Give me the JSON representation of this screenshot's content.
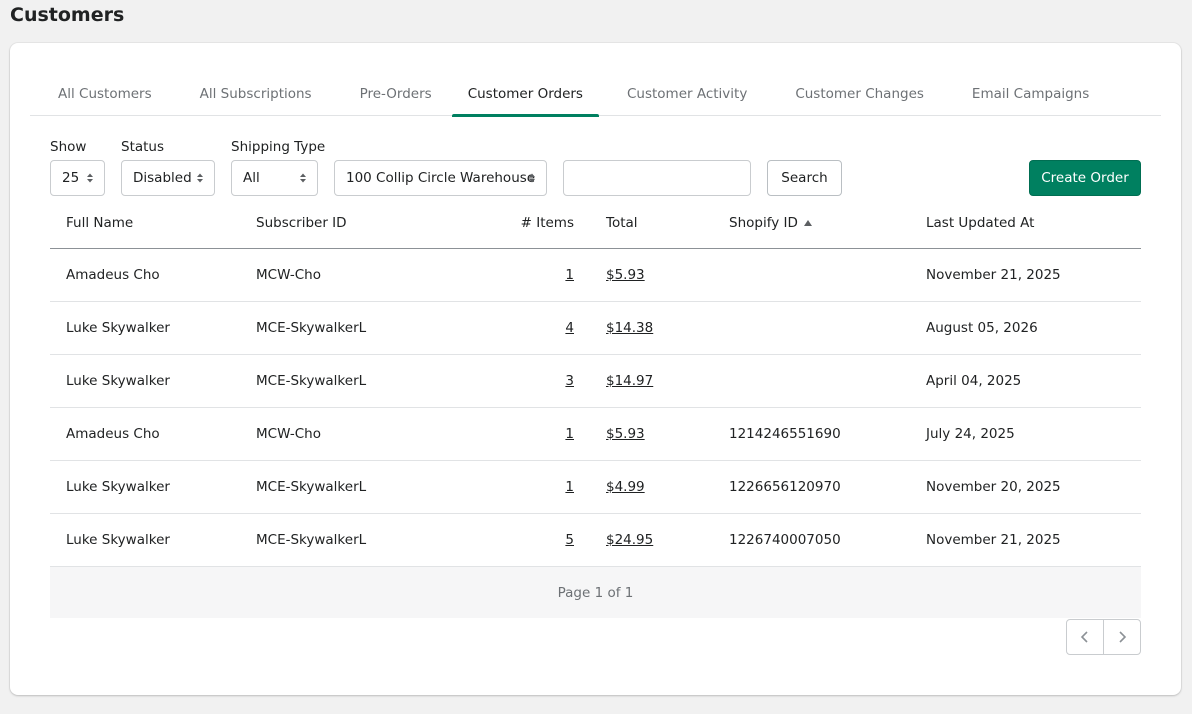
{
  "page": {
    "title": "Customers"
  },
  "tabs": [
    {
      "label": "All Customers",
      "active": false
    },
    {
      "label": "All Subscriptions",
      "active": false
    },
    {
      "label": "Pre-Orders",
      "active": false
    },
    {
      "label": "Customer Orders",
      "active": true
    },
    {
      "label": "Customer Activity",
      "active": false
    },
    {
      "label": "Customer Changes",
      "active": false
    },
    {
      "label": "Email Campaigns",
      "active": false
    }
  ],
  "filters": {
    "show": {
      "label": "Show",
      "value": "25"
    },
    "status": {
      "label": "Status",
      "value": "Disabled"
    },
    "shipping": {
      "label": "Shipping Type",
      "value": "All"
    },
    "warehouse": {
      "value": "100 Collip Circle Warehouse"
    },
    "search": {
      "value": "",
      "button": "Search"
    },
    "create_button": "Create Order"
  },
  "table": {
    "headers": {
      "name": "Full Name",
      "subscriber": "Subscriber ID",
      "items": "# Items",
      "total": "Total",
      "shopify": "Shopify ID",
      "updated": "Last Updated At"
    },
    "sort": {
      "column": "Shopify ID",
      "direction": "ascending"
    },
    "rows": [
      {
        "name": "Amadeus Cho",
        "subscriber": "MCW-Cho",
        "items": "1",
        "total": "$5.93",
        "shopify": "",
        "updated": "November 21, 2025"
      },
      {
        "name": "Luke Skywalker",
        "subscriber": "MCE-SkywalkerL",
        "items": "4",
        "total": "$14.38",
        "shopify": "",
        "updated": "August 05, 2026"
      },
      {
        "name": "Luke Skywalker",
        "subscriber": "MCE-SkywalkerL",
        "items": "3",
        "total": "$14.97",
        "shopify": "",
        "updated": "April 04, 2025"
      },
      {
        "name": "Amadeus Cho",
        "subscriber": "MCW-Cho",
        "items": "1",
        "total": "$5.93",
        "shopify": "1214246551690",
        "updated": "July 24, 2025"
      },
      {
        "name": "Luke Skywalker",
        "subscriber": "MCE-SkywalkerL",
        "items": "1",
        "total": "$4.99",
        "shopify": "1226656120970",
        "updated": "November 20, 2025"
      },
      {
        "name": "Luke Skywalker",
        "subscriber": "MCE-SkywalkerL",
        "items": "5",
        "total": "$24.95",
        "shopify": "1226740007050",
        "updated": "November 21, 2025"
      }
    ],
    "footer": "Page 1 of 1"
  },
  "pagination": {
    "prev_icon": "chevron-left-icon",
    "next_icon": "chevron-right-icon"
  },
  "colors": {
    "accent": "#008060",
    "background": "#f1f1f1"
  }
}
